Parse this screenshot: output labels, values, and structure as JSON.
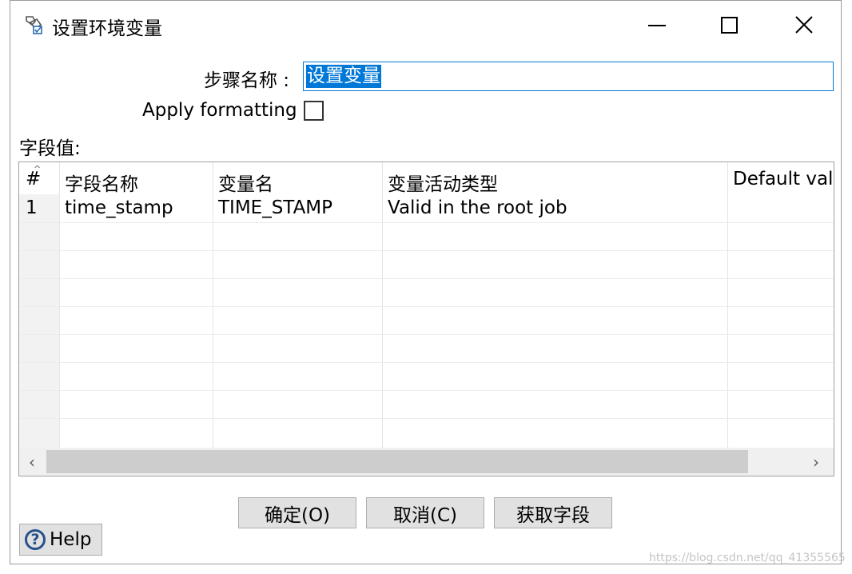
{
  "window": {
    "title": "设置环境变量"
  },
  "form": {
    "step_label": "步骤名称 :",
    "step_value": "设置变量",
    "apply_label": "Apply formatting",
    "fields_label": "字段值:"
  },
  "table": {
    "columns": [
      "#",
      "字段名称",
      "变量名",
      "变量活动类型",
      "Default val"
    ],
    "rows": [
      {
        "num": "1",
        "field": "time_stamp",
        "var": "TIME_STAMP",
        "type": "Valid in the root job",
        "default": ""
      }
    ]
  },
  "buttons": {
    "ok": "确定(O)",
    "cancel": "取消(C)",
    "get_fields": "获取字段",
    "help": "Help"
  },
  "icons": [
    "settings-dialog-icon",
    "minimize-icon",
    "maximize-icon",
    "close-icon",
    "help-icon",
    "scroll-left-icon",
    "scroll-right-icon"
  ],
  "watermark": "https://blog.csdn.net/qq_41355565"
}
